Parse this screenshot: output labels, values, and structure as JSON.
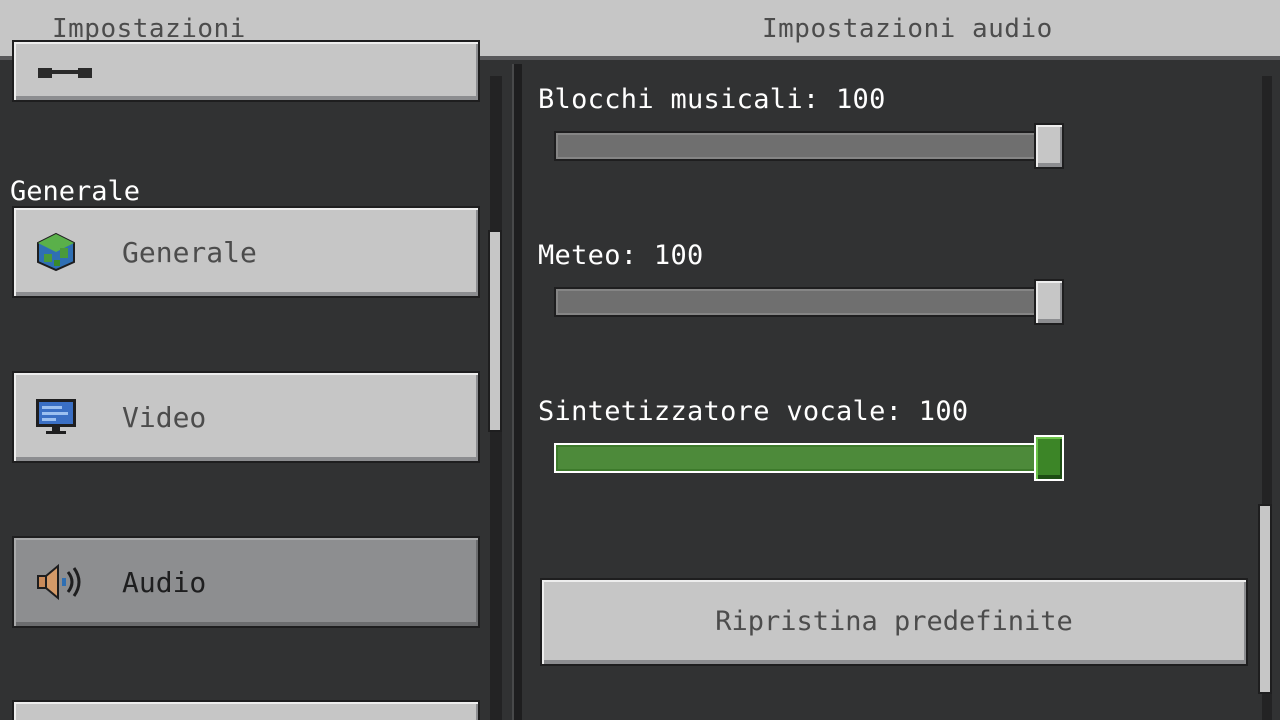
{
  "header": {
    "left_title": "Impostazioni",
    "right_title": "Impostazioni audio"
  },
  "sidebar": {
    "section_title": "Generale",
    "items": [
      {
        "label": "Generale",
        "icon": "globe-icon",
        "selected": false
      },
      {
        "label": "Video",
        "icon": "monitor-icon",
        "selected": false
      },
      {
        "label": "Audio",
        "icon": "speaker-icon",
        "selected": true
      }
    ]
  },
  "audio": {
    "sliders": [
      {
        "label": "Blocchi musicali: 100",
        "value": 100,
        "max": 100,
        "focused": false
      },
      {
        "label": "Meteo: 100",
        "value": 100,
        "max": 100,
        "focused": false
      },
      {
        "label": "Sintetizzatore vocale: 100",
        "value": 100,
        "max": 100,
        "focused": true
      }
    ],
    "reset_label": "Ripristina predefinite"
  },
  "colors": {
    "panel_bg": "#313233",
    "button_bg": "#c6c6c6",
    "selected_bg": "#8d8e90",
    "focus_green": "#3c8527"
  }
}
